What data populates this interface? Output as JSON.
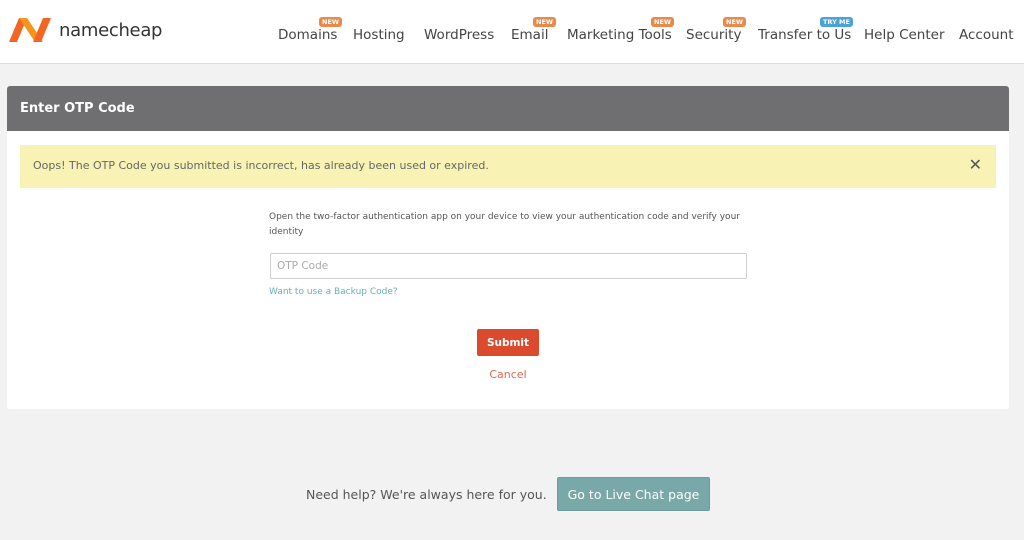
{
  "header": {
    "logo_text": "namecheap",
    "brand_color": "#f26522"
  },
  "nav": [
    {
      "label": "Domains",
      "badge": "NEW"
    },
    {
      "label": "Hosting",
      "badge": ""
    },
    {
      "label": "WordPress",
      "badge": ""
    },
    {
      "label": "Email",
      "badge": "NEW"
    },
    {
      "label": "Marketing Tools",
      "badge": "NEW"
    },
    {
      "label": "Security",
      "badge": "NEW"
    },
    {
      "label": "Transfer to Us",
      "badge": "TRY ME"
    },
    {
      "label": "Help Center",
      "badge": ""
    },
    {
      "label": "Account",
      "badge": ""
    }
  ],
  "panel": {
    "title": "Enter OTP Code",
    "alert": "Oops! The OTP Code you submitted is incorrect, has already been used or expired.",
    "alert_close": "✕",
    "instructions": "Open the two-factor authentication app on your device to view your authentication code and verify your identity",
    "otp_placeholder": "OTP Code",
    "backup_link": "Want to use a Backup Code?",
    "submit_label": "Submit",
    "cancel_label": "Cancel"
  },
  "footer": {
    "help_text": "Need help? We're always here for you.",
    "chat_button": "Go to Live Chat page"
  },
  "colors": {
    "header_bar": "#6f6f71",
    "alert_bg": "#f8f2b4",
    "submit": "#dc4a2e",
    "chat_button": "#78a8a8",
    "badge_new": "#e88a4a",
    "badge_try": "#4aa3d8"
  }
}
